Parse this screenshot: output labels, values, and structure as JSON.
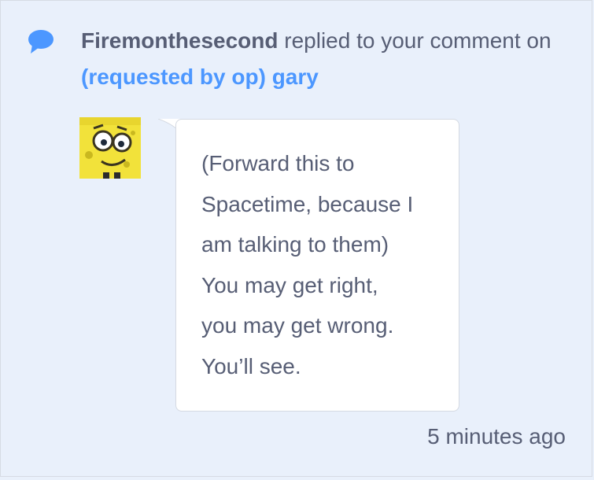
{
  "notification": {
    "icon": "comment-bubble-icon",
    "actor": "Firemonthesecond",
    "action_text": " replied to your comment on ",
    "target_link": "(requested by op) gary",
    "reply_text": "(Forward this to\nSpacetime, because I\nam talking to them)\nYou may get right,\nyou may get wrong.\nYou’ll see.",
    "timestamp": "5 minutes ago",
    "avatar": "yellow-cartoon-avatar"
  },
  "colors": {
    "background": "#e9f0fb",
    "text": "#575e75",
    "link": "#4c97ff",
    "bubble": "#ffffff",
    "icon": "#4c97ff"
  }
}
